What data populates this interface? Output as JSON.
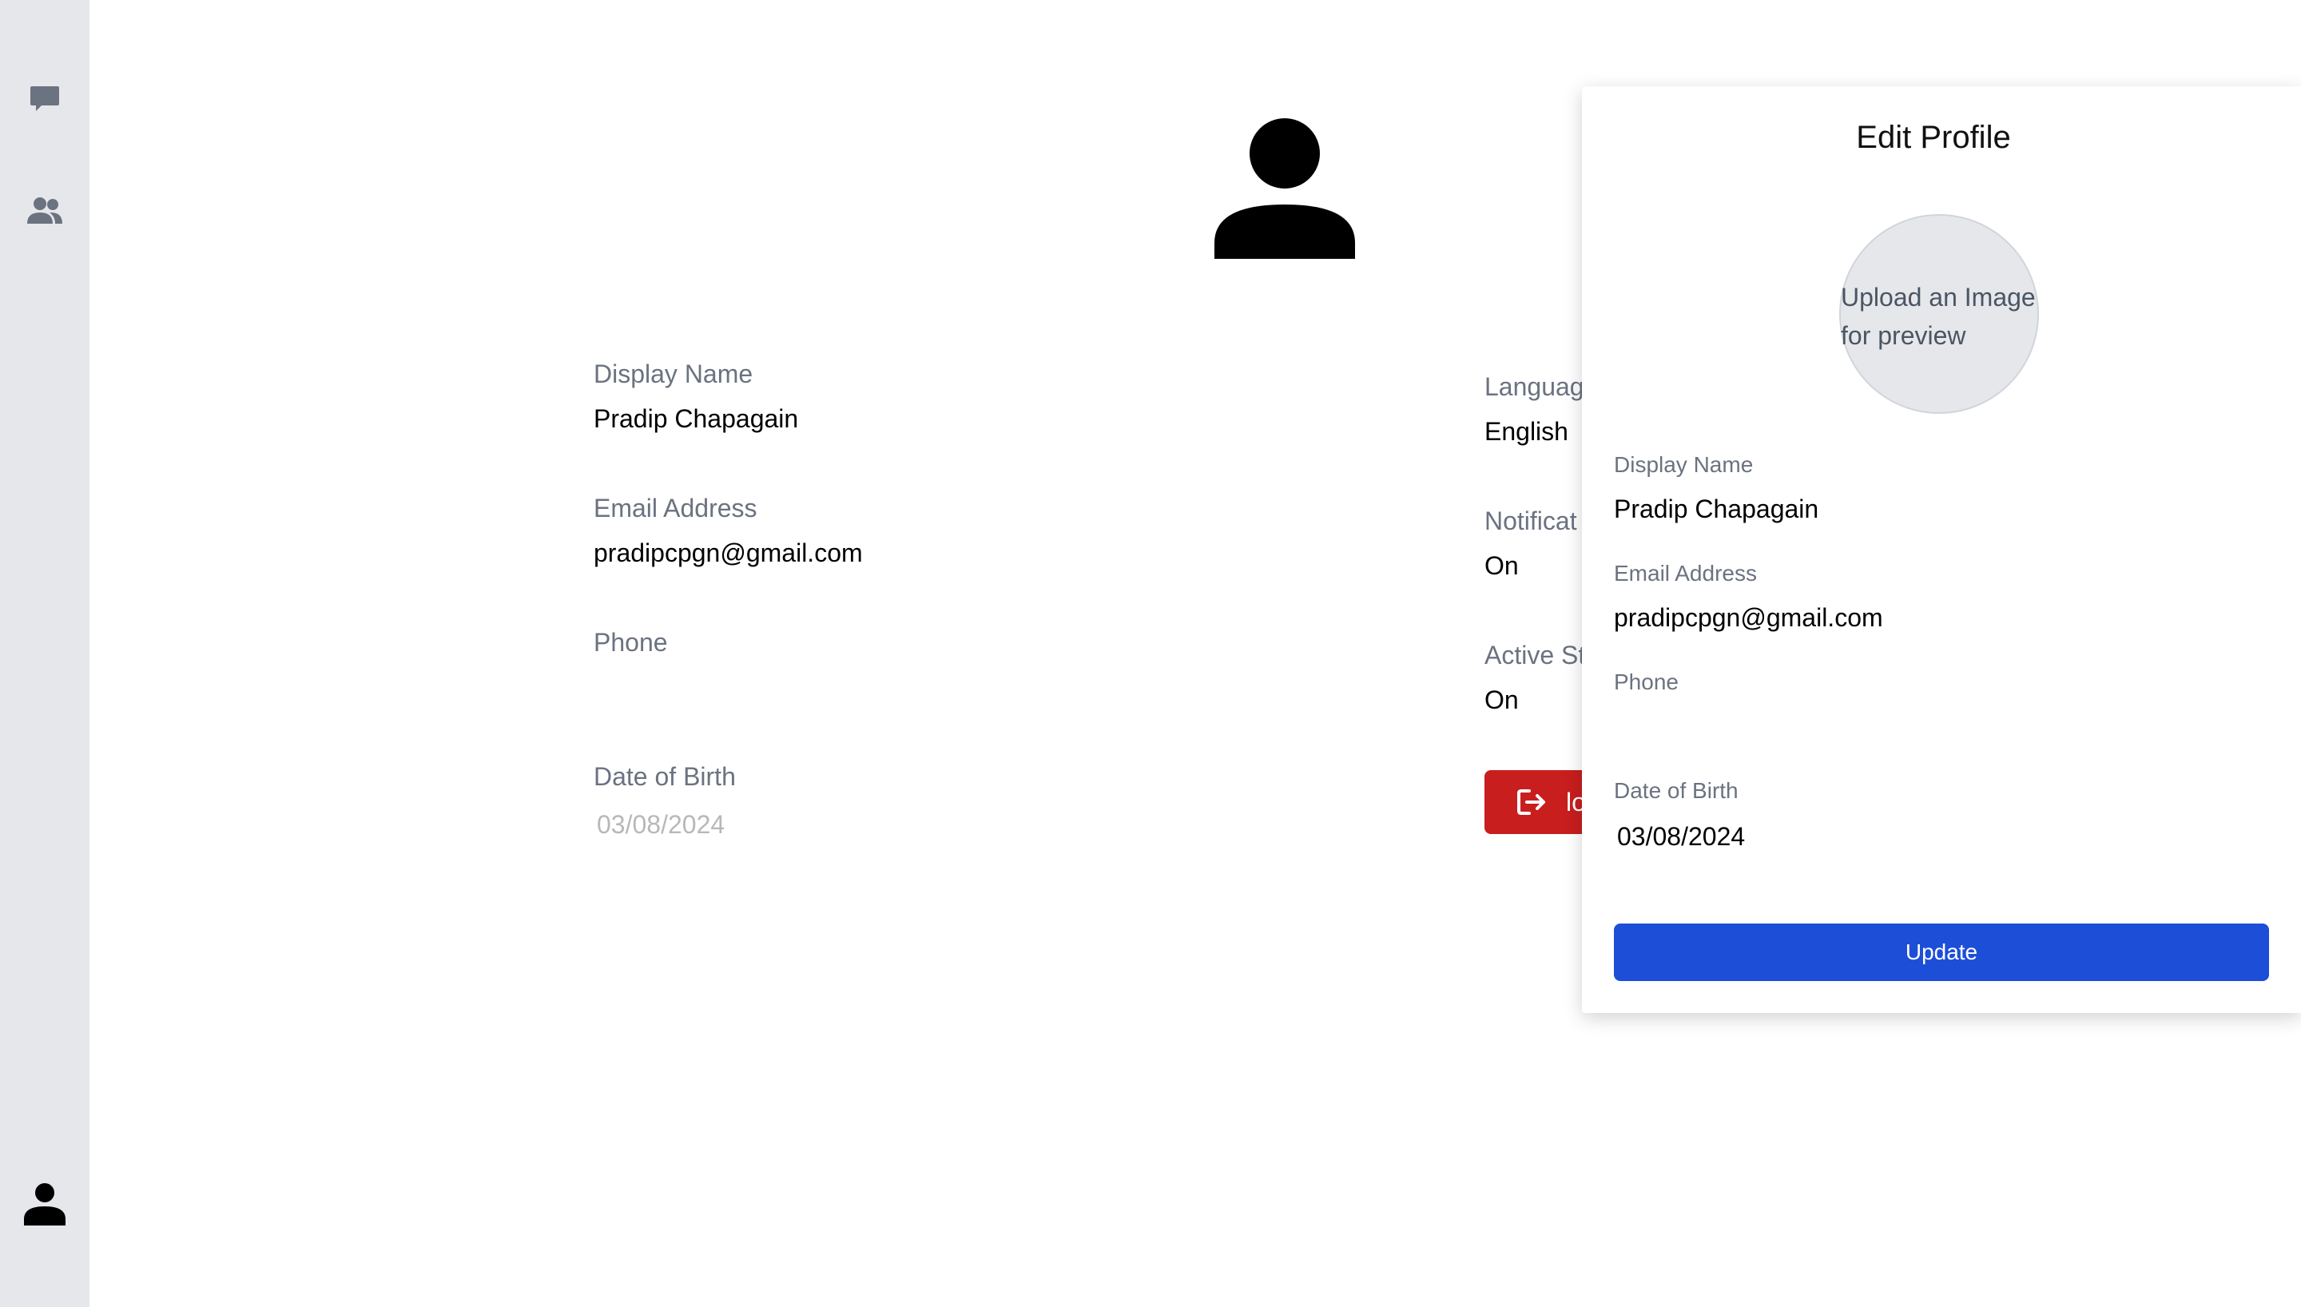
{
  "sidebar": {
    "items": [
      {
        "icon": "chat-bubble-icon"
      },
      {
        "icon": "users-icon"
      },
      {
        "icon": "user-profile-icon"
      }
    ]
  },
  "profile": {
    "display_name": {
      "label": "Display Name",
      "value": "Pradip Chapagain"
    },
    "email": {
      "label": "Email Address",
      "value": "pradipcpgn@gmail.com"
    },
    "phone": {
      "label": "Phone",
      "value": ""
    },
    "dob": {
      "label": "Date of Birth",
      "value": "03/08/2024"
    },
    "language": {
      "label": "Languag",
      "value": "English"
    },
    "notifications": {
      "label": "Notificat",
      "value": "On"
    },
    "active_status": {
      "label": "Active St",
      "value": "On"
    },
    "logout_label": "lo"
  },
  "edit_panel": {
    "title": "Edit Profile",
    "upload_text": "Upload an Image for preview",
    "display_name": {
      "label": "Display Name",
      "value": "Pradip Chapagain"
    },
    "email": {
      "label": "Email Address",
      "value": "pradipcpgn@gmail.com"
    },
    "phone": {
      "label": "Phone",
      "value": ""
    },
    "dob": {
      "label": "Date of Birth",
      "value": "03/08/2024"
    },
    "update_label": "Update"
  },
  "colors": {
    "sidebar_bg": "#e5e7eb",
    "logout_red": "#c81e1e",
    "update_blue": "#1d4ed8",
    "label_gray": "#6b7280"
  }
}
